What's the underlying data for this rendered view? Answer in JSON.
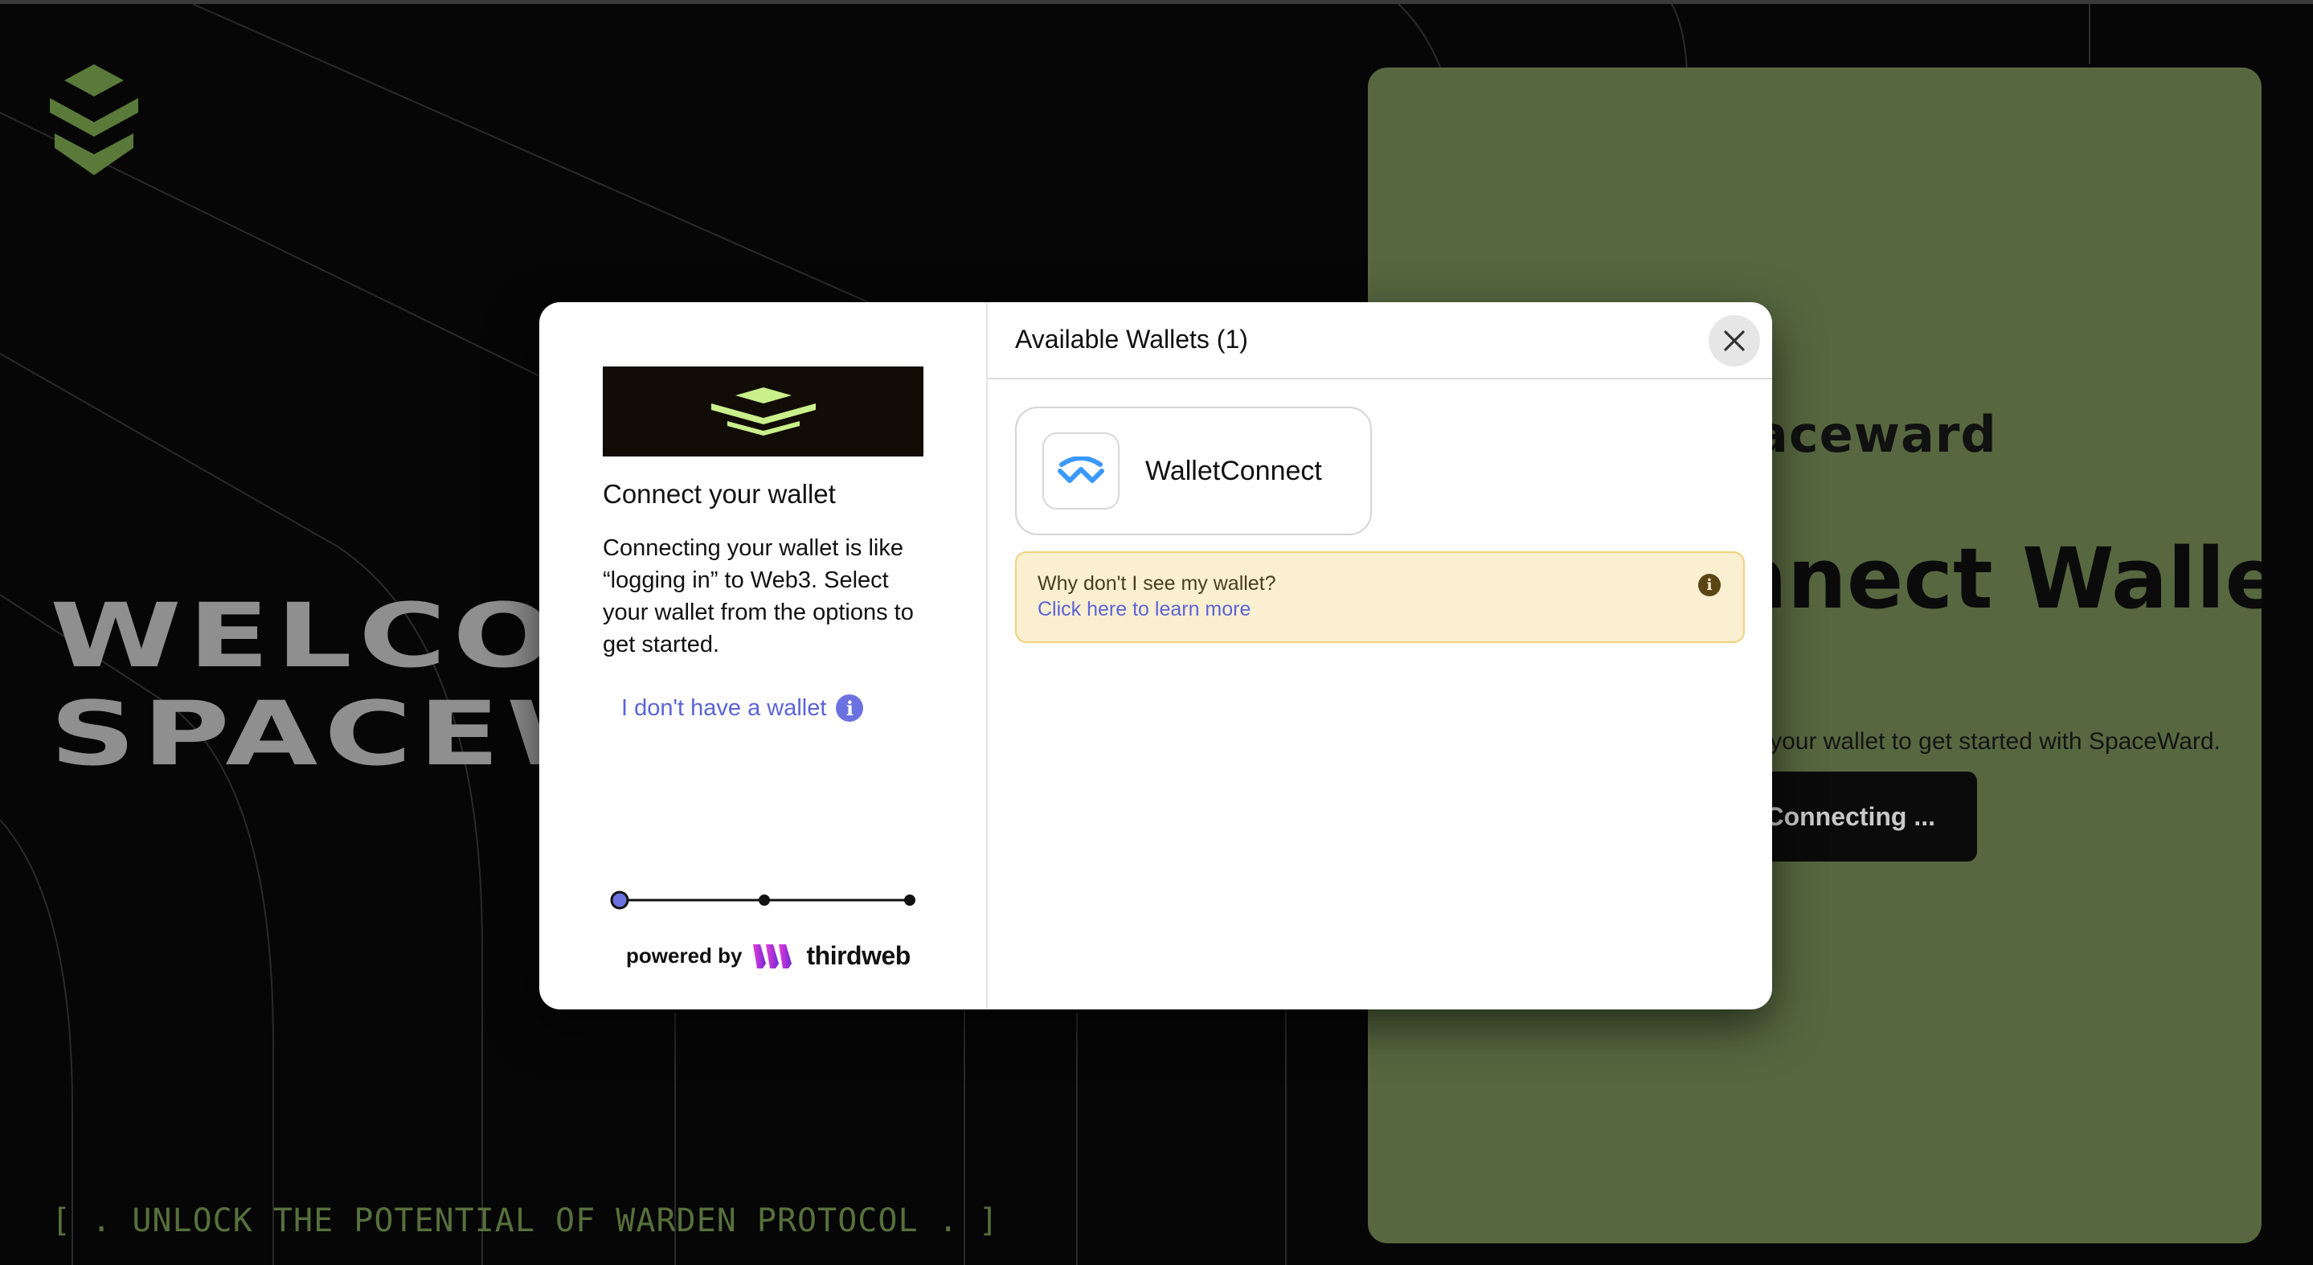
{
  "background": {
    "welcome_lines": [
      "WELCOME TO",
      "SPACEWARD"
    ],
    "tagline": "[ . UNLOCK THE POTENTIAL OF WARDEN PROTOCOL . ]",
    "colors": {
      "bg": "#060606",
      "logo_green": "#5a7a3a",
      "tagline": "#57703c"
    }
  },
  "green_card": {
    "brand": "Spaceward",
    "title": "Connect Wallet",
    "subtitle": "Connect your wallet to get started with SpaceWard.",
    "button_label": "Connecting ...",
    "color": "#576840"
  },
  "modal": {
    "left": {
      "title": "Connect your wallet",
      "body": "Connecting your wallet is like “logging in” to Web3. Select your wallet from the options to get started.",
      "no_wallet_link": "I don't have a wallet",
      "info_glyph": "i",
      "powered_by": "powered by",
      "provider": "thirdweb"
    },
    "right": {
      "title": "Available Wallets (1)",
      "wallets": [
        {
          "name": "WalletConnect",
          "icon": "walletconnect-icon"
        }
      ],
      "notice": {
        "question": "Why don't I see my wallet?",
        "link": "Click here to learn more",
        "info_glyph": "i"
      }
    },
    "colors": {
      "accent": "#5b64d6",
      "notice_bg": "#fbefd2",
      "banner_bg": "#120c07",
      "banner_logo": "#c9f08a"
    }
  }
}
